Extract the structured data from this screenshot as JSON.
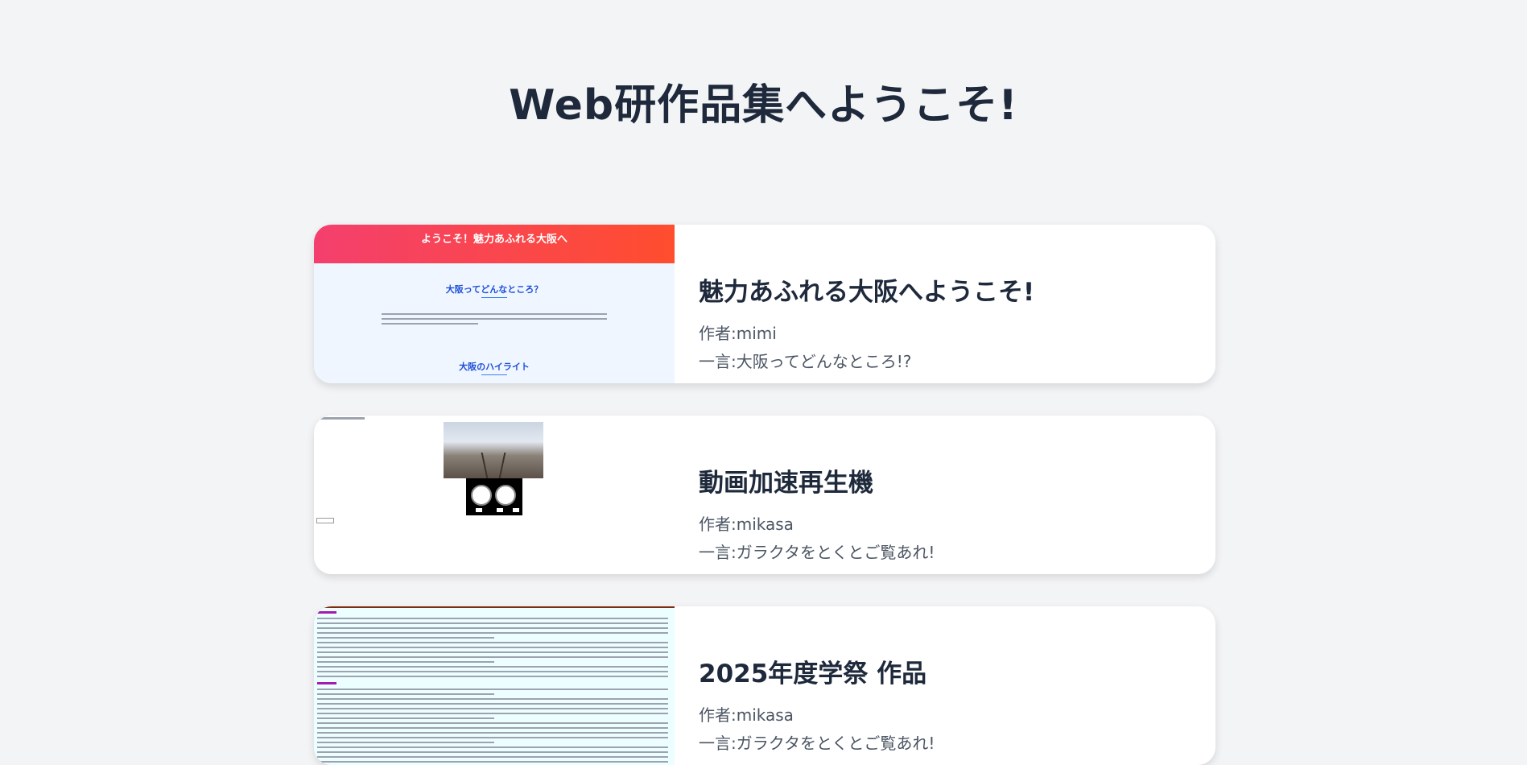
{
  "page": {
    "title": "Web研作品集へようこそ!"
  },
  "works": [
    {
      "title": "魅力あふれる大阪へようこそ!",
      "author": "作者:mimi",
      "comment": "一言:大阪ってどんなところ!?",
      "thumbnail": {
        "header": "ようこそ！魅力あふれる大阪へ",
        "heading1": "大阪ってどんなところ？",
        "heading2": "大阪のハイライト"
      }
    },
    {
      "title": "動画加速再生機",
      "author": "作者:mikasa",
      "comment": "一言:ガラクタをとくとご覧あれ!"
    },
    {
      "title": "2025年度学祭 作品",
      "author": "作者:mikasa",
      "comment": "一言:ガラクタをとくとご覧あれ!"
    }
  ]
}
